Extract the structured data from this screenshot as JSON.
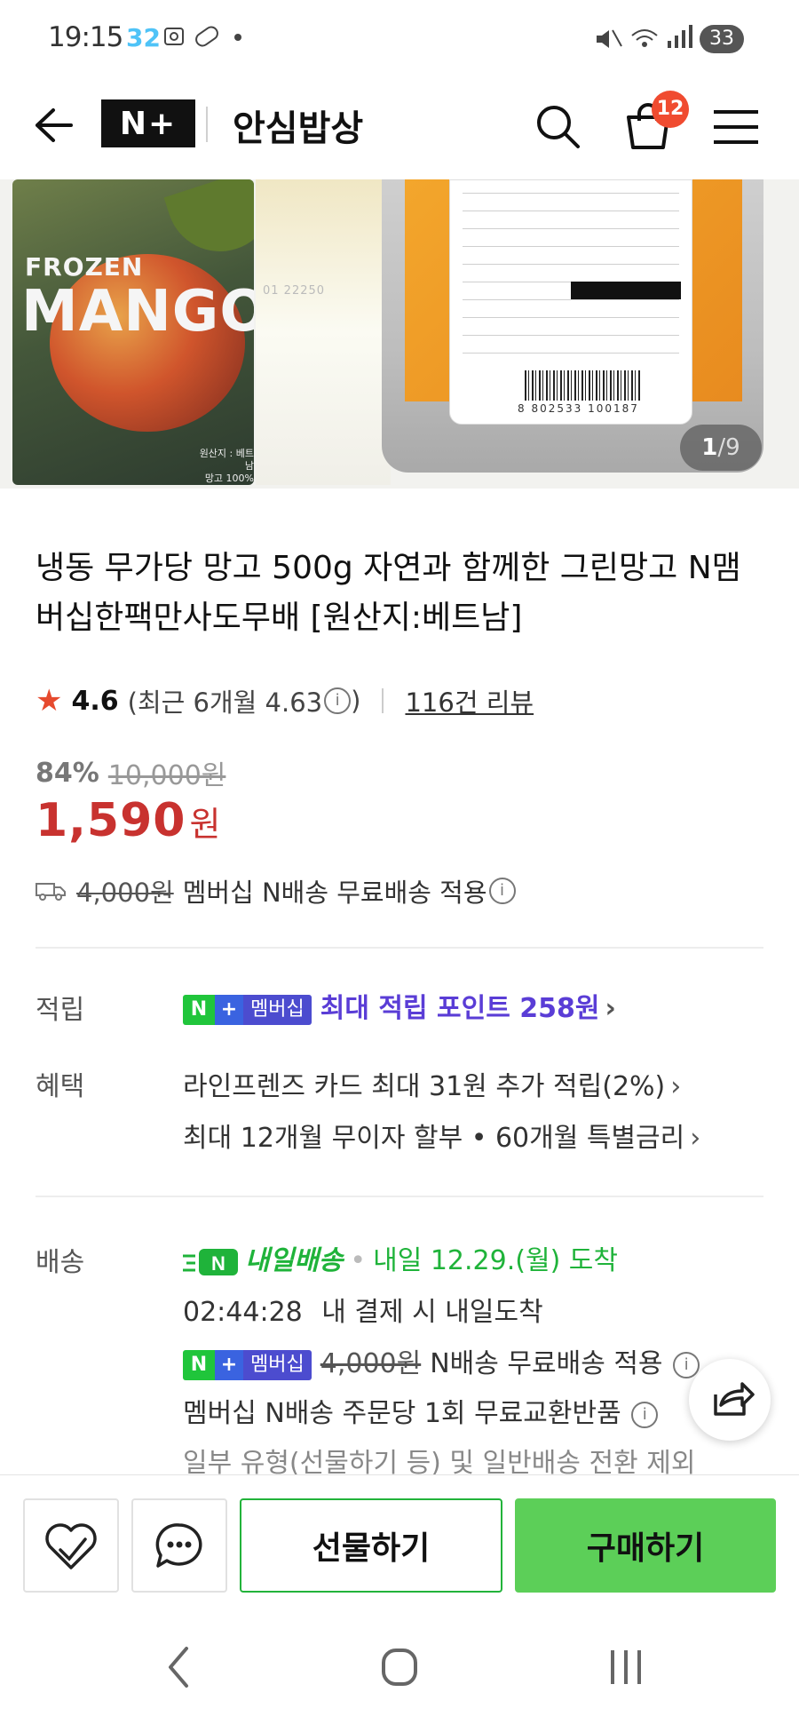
{
  "status_bar": {
    "time": "19:15",
    "notification_count": "32",
    "battery": "33"
  },
  "header": {
    "logo": "N+",
    "store_name": "안심밥상",
    "cart_count": "12"
  },
  "gallery": {
    "frozen_text": "FROZEN",
    "mango_text": "MANGO",
    "origin_line1": "원산지 : 베트남",
    "origin_line2": "망고 100%",
    "barcode_number": "8 802533 100187",
    "middle_code": "01 22250",
    "page_current": "1",
    "page_separator": "/",
    "page_total": "9"
  },
  "product": {
    "title": "냉동 무가당 망고 500g 자연과 함께한 그린망고 N맴버십한팩만사도무배 [원산지:베트남]",
    "rating": "4.6",
    "recent_rating_prefix": "(최근 6개월 4.63",
    "recent_rating_suffix": ")",
    "review_count": "116건 리뷰",
    "discount_rate": "84%",
    "original_price": "10,000원",
    "price": "1,590",
    "price_unit": "원",
    "shipping_original": "4,000원",
    "shipping_text": "멤버십 N배송 무료배송 적용"
  },
  "points": {
    "label": "적립",
    "badge_n": "N",
    "badge_plus": "+",
    "badge_membership": "멤버십",
    "text": "최대 적립 포인트 258원"
  },
  "benefits": {
    "label": "혜택",
    "line1": "라인프렌즈 카드 최대 31원 추가 적립(2%)",
    "line2": "최대 12개월 무이자 할부 • 60개월 특별금리"
  },
  "delivery": {
    "label": "배송",
    "tag": "내일배송",
    "dot": "•",
    "arrival": "내일 12.29.(월) 도착",
    "countdown": "02:44:28",
    "countdown_text": "내 결제 시 내일도착",
    "shipping_original": "4,000원",
    "shipping_text": "N배송 무료배송 적용",
    "exchange_text": "멤버십 N배송 주문당 1회 무료교환반품",
    "exclusion_text": "일부 유형(선물하기 등) 및 일반배송 전환 제외"
  },
  "actions": {
    "gift": "선물하기",
    "buy": "구매하기"
  },
  "colors": {
    "price_red": "#c8322f",
    "naver_green": "#20c53b",
    "buy_green": "#5ccf58",
    "points_purple": "#5a3dd6",
    "badge_red": "#f04b30"
  }
}
